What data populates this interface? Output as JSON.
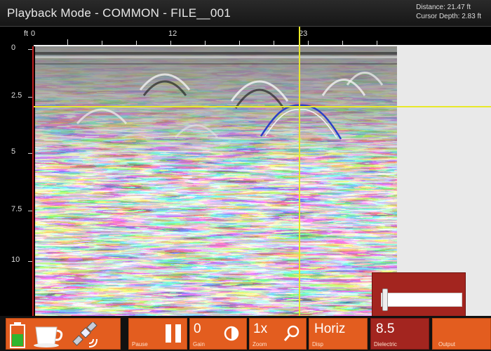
{
  "window": {
    "title": "Playback Mode - COMMON - FILE__001",
    "distance": "Distance: 21.47 ft",
    "cursor_depth": "Cursor Depth: 2.83 ft"
  },
  "horizontal_ruler": {
    "unit": "ft",
    "labels": [
      "0",
      "12",
      "23"
    ]
  },
  "vertical_ruler": {
    "labels": [
      "0",
      "2.5",
      "5",
      "7.5",
      "10"
    ]
  },
  "toolbar": {
    "pause": {
      "label": "Pause"
    },
    "gain": {
      "value": "0",
      "label": "Gain"
    },
    "zoom": {
      "value": "1x",
      "label": "Zoom"
    },
    "display": {
      "value": "Horiz",
      "label": "Disp"
    },
    "dielectric": {
      "value": "8.5",
      "label": "Dielectric"
    },
    "output": {
      "label": "Output"
    }
  },
  "colors": {
    "accent": "#e35d1f",
    "dark_accent": "#a3251f",
    "crosshair": "#e8e82a"
  }
}
